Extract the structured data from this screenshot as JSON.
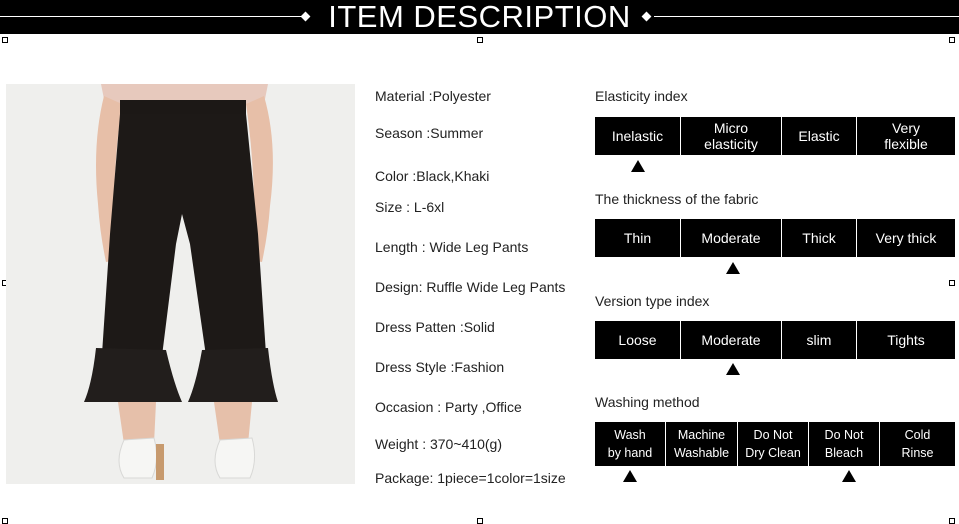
{
  "banner": {
    "title": "ITEM DESCRIPTION"
  },
  "specs": [
    "Material :Polyester",
    "Season :Summer",
    "Color :Black,Khaki",
    "Size : L-6xl",
    "Length : Wide Leg Pants",
    "Design: Ruffle Wide Leg Pants",
    "Dress Patten :Solid",
    "Dress Style :Fashion",
    "Occasion : Party ,Office",
    "Weight : 370~410(g)",
    "Package: 1piece=1color=1size"
  ],
  "sections": [
    {
      "title": "Elasticity index",
      "options": [
        "Inelastic",
        "Micro elasticity",
        "Elastic",
        "Very flexible"
      ],
      "selected": [
        "Inelastic"
      ]
    },
    {
      "title": "The thickness of the fabric",
      "options": [
        "Thin",
        "Moderate",
        "Thick",
        "Very thick"
      ],
      "selected": [
        "Moderate"
      ]
    },
    {
      "title": "Version type index",
      "options": [
        "Loose",
        "Moderate",
        "slim",
        "Tights"
      ],
      "selected": [
        "Moderate"
      ]
    },
    {
      "title": "Washing method",
      "options": [
        "Wash by hand",
        "Machine Washable",
        "Do Not Dry Clean",
        "Do Not Bleach",
        "Cold Rinse"
      ],
      "selected": [
        "Wash by hand",
        "Do Not Bleach"
      ]
    }
  ]
}
